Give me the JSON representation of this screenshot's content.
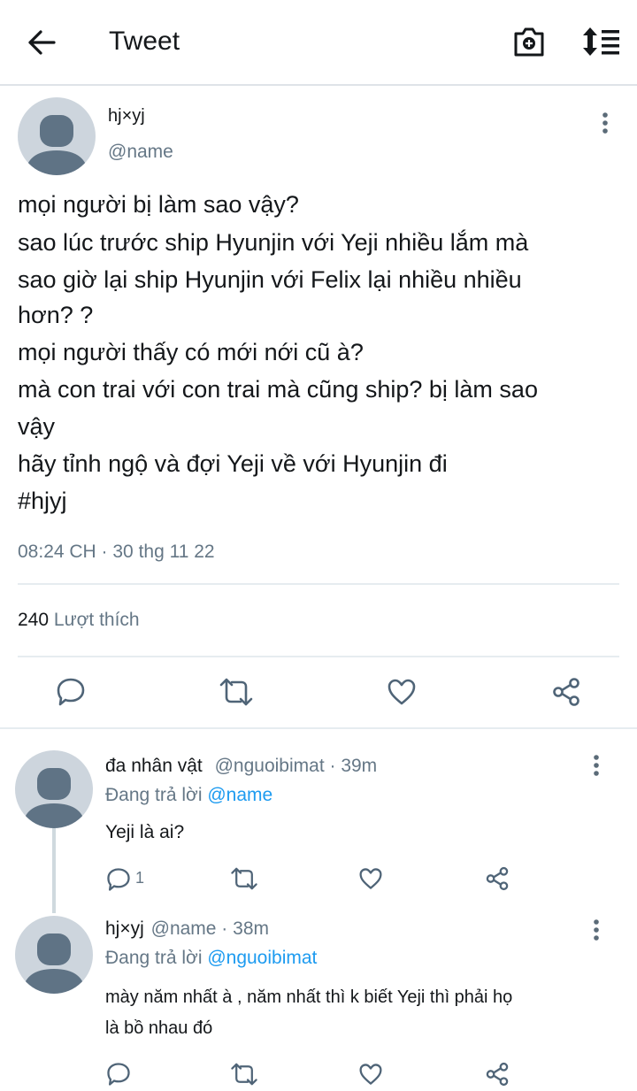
{
  "header": {
    "title": "Tweet"
  },
  "main_tweet": {
    "author_name": "hj×yj",
    "author_handle": "@name",
    "lines": [
      "mọi người bị làm sao vậy?",
      "sao lúc trước ship Hyunjin với Yeji nhiều lắm mà",
      "sao giờ lại ship Hyunjin với Felix lại nhiều nhiều",
      "hơn? ?",
      "mọi người thấy có mới nới cũ à?",
      "mà con trai với con trai mà cũng ship?  bị làm sao",
      "vậy",
      "hãy tỉnh ngộ và đợi Yeji về với Hyunjin đi"
    ],
    "hashtag": "#hjyj",
    "timestamp": "08:24 CH · 30 thg 11 22",
    "likes_count": "240",
    "likes_label": "Lượt thích"
  },
  "replies": [
    {
      "name": "đa nhân vật",
      "handle_time": "@nguoibimat · 39m",
      "replying_prefix": "Đang trả lời",
      "replying_to": "@name",
      "text_lines": [
        "Yeji là ai?"
      ],
      "reply_count": "1"
    },
    {
      "name": "hj×yj",
      "handle_time": "@name · 38m",
      "replying_prefix": "Đang trả lời",
      "replying_to": "@nguoibimat",
      "text_lines": [
        "mày năm nhất à ,  năm nhất thì k biết Yeji thì phải họ",
        "là bồ nhau đó"
      ],
      "reply_count": ""
    }
  ],
  "colors": {
    "accent": "#1d9bf0",
    "muted": "#657786",
    "icon": "#4f6477",
    "avatar_bg": "#cdd5dd",
    "avatar_fg": "#5f7385"
  }
}
